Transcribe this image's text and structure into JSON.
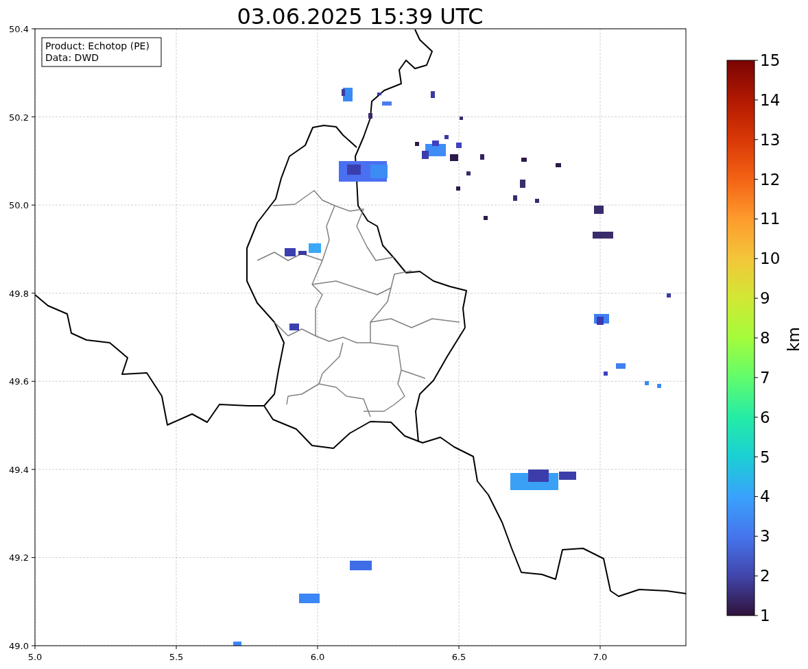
{
  "title": "03.06.2025 15:39 UTC",
  "legend": [
    "Product: Echotop (PE)",
    "Data: DWD"
  ],
  "x_axis": {
    "ticks": [
      "5.0",
      "5.5",
      "6.0",
      "6.5",
      "7.0"
    ]
  },
  "y_axis": {
    "ticks": [
      "50.4",
      "50.2",
      "50.0",
      "49.8",
      "49.6",
      "49.4",
      "49.2",
      "49.0"
    ]
  },
  "colorbar": {
    "label": "km",
    "ticks": [
      "15",
      "14",
      "13",
      "12",
      "11",
      "10",
      "9",
      "8",
      "7",
      "6",
      "5",
      "4",
      "3",
      "2",
      "1"
    ]
  }
}
